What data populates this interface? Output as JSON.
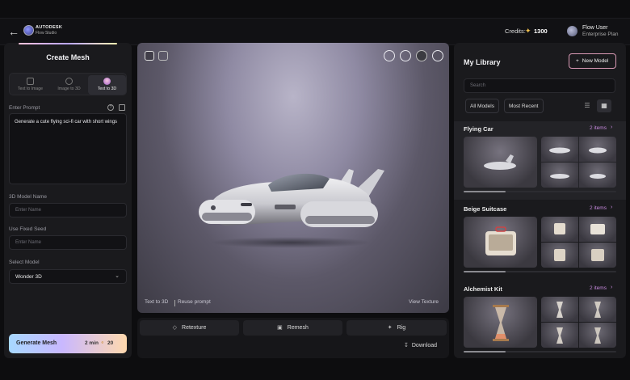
{
  "topbar": {
    "brand": "AUTODESK",
    "product": "Flow Studio",
    "credits_label": "Credits:",
    "credits_value": "1300",
    "user_name": "Flow User",
    "user_plan": "Enterprise Plan"
  },
  "left": {
    "title": "Create Mesh",
    "modes": [
      {
        "label": "Text to Image"
      },
      {
        "label": "Image to 3D"
      },
      {
        "label": "Text to 3D"
      }
    ],
    "active_mode": "Text to 3D",
    "prompt_label": "Enter Prompt",
    "prompt_value": "Generate a cute flying sci-fi car with short wings",
    "model_name_label": "3D Model Name",
    "model_name_placeholder": "Enter Name",
    "seed_label": "Use Fixed Seed",
    "seed_placeholder": "Enter Name",
    "select_model_label": "Select Model",
    "select_model_value": "Wonder 3D",
    "generate_label": "Generate Mesh",
    "generate_time": "2 min",
    "generate_cost": "20"
  },
  "viewport": {
    "mode_label": "Text to 3D",
    "reuse_label": "Reuse prompt",
    "view_texture_label": "View Texture"
  },
  "actions": {
    "retexture": "Retexture",
    "remesh": "Remesh",
    "rig": "Rig",
    "download": "Download"
  },
  "library": {
    "title": "My Library",
    "new_model": "New Model",
    "search_placeholder": "Search",
    "filter_all": "All Models",
    "filter_recent": "Most Recent",
    "sections": [
      {
        "title": "Flying Car",
        "count": "2 items"
      },
      {
        "title": "Beige Suitcase",
        "count": "2 items"
      },
      {
        "title": "Alchemist Kit",
        "count": "2 items"
      }
    ]
  },
  "colors": {
    "accent_pink": "#d99ab5",
    "accent_purple": "#c98be0",
    "panel_bg": "#1a1a1d",
    "credit_star": "#f2c14e"
  }
}
